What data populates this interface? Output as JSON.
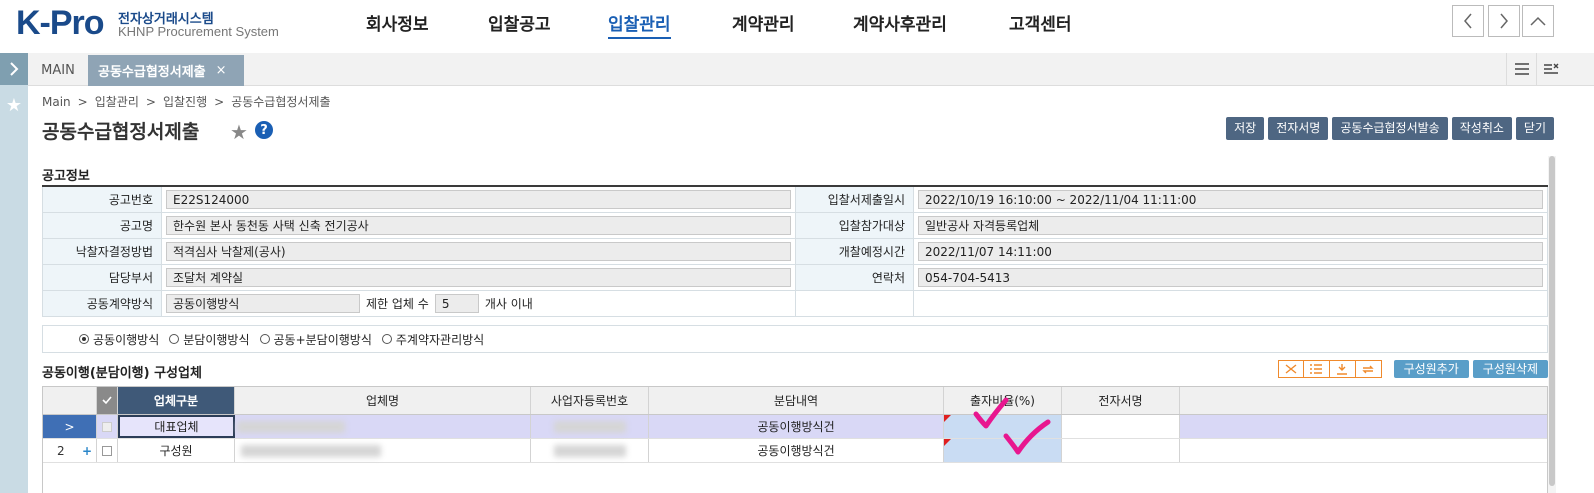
{
  "header": {
    "logo": "K-Pro",
    "logo_sub_ko": "전자상거래시스템",
    "logo_sub_en": "KHNP Procurement System",
    "menu": [
      {
        "label": "회사정보",
        "active": false
      },
      {
        "label": "입찰공고",
        "active": false
      },
      {
        "label": "입찰관리",
        "active": true
      },
      {
        "label": "계약관리",
        "active": false
      },
      {
        "label": "계약사후관리",
        "active": false
      },
      {
        "label": "고객센터",
        "active": false
      }
    ],
    "nav_icons": [
      "chevron-left-icon",
      "chevron-right-icon",
      "chevron-up-icon"
    ]
  },
  "tabs": {
    "main": "MAIN",
    "active": "공동수급협정서제출",
    "close": "×"
  },
  "breadcrumb": [
    "Main",
    "입찰관리",
    "입찰진행",
    "공동수급협정서제출"
  ],
  "breadcrumb_sep": ">",
  "page_title": "공동수급협정서제출",
  "help_label": "?",
  "actions": [
    "저장",
    "전자서명",
    "공동수급협정서발송",
    "작성취소",
    "닫기"
  ],
  "notice_section": {
    "title": "공고정보",
    "labels": {
      "notice_no": "공고번호",
      "submit_period": "입찰서제출일시",
      "notice_name": "공고명",
      "eligibility": "입찰참가대상",
      "award_method": "낙찰자결정방법",
      "opening_time": "개찰예정시간",
      "department": "담당부서",
      "contact": "연락처",
      "joint_method": "공동계약방식"
    },
    "values": {
      "notice_no": "E22S124000",
      "submit_period": "2022/10/19 16:10:00 ~ 2022/11/04 11:11:00",
      "notice_name": "한수원 본사 동천동 사택 신축 전기공사",
      "eligibility": "일반공사 자격등록업체",
      "award_method": "적격심사 낙찰제(공사)",
      "opening_time": "2022/11/07 14:11:00",
      "department": "조달처 계약실",
      "contact": "054-704-5413",
      "joint_method": "공동이행방식",
      "limit_label": "제한 업체 수",
      "limit_value": "5",
      "limit_suffix": "개사 이내"
    }
  },
  "method_options": [
    {
      "label": "공동이행방식",
      "selected": true
    },
    {
      "label": "분담이행방식",
      "selected": false
    },
    {
      "label": "공동+분담이행방식",
      "selected": false
    },
    {
      "label": "주계약자관리방식",
      "selected": false
    }
  ],
  "member_section": {
    "title": "공동이행(분담이행) 구성업체",
    "grid_tools": [
      "excel-icon",
      "list-icon",
      "download-icon",
      "refresh-icon"
    ],
    "add_button": "구성원추가",
    "delete_button": "구성원삭제",
    "columns": [
      "업체구분",
      "업체명",
      "사업자등록번호",
      "분담내역",
      "출자비율(%)",
      "전자서명"
    ],
    "rows": [
      {
        "row_head": ">",
        "type": "대표업체",
        "detail": "공동이행방식건",
        "ratio": "",
        "sign": ""
      },
      {
        "row_head": "2",
        "plus": "+",
        "type": "구성원",
        "detail": "공동이행방식건",
        "ratio": "",
        "sign": ""
      }
    ]
  },
  "colors": {
    "brand": "#1a4a8a",
    "button": "#4e6682",
    "grid_header": "#3f5978",
    "selected_row": "#d9d8f6",
    "annotation": "#e8168f"
  }
}
